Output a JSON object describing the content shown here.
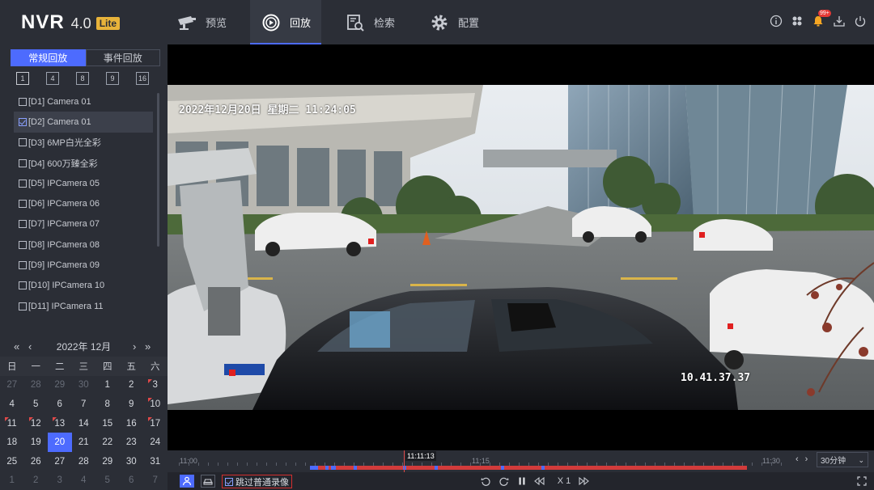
{
  "header": {
    "logo_main": "NVR",
    "logo_version": "4.0",
    "logo_badge": "Lite",
    "nav": [
      {
        "label": "预览",
        "icon": "camera-icon"
      },
      {
        "label": "回放",
        "icon": "playback-icon"
      },
      {
        "label": "检索",
        "icon": "search-doc-icon"
      },
      {
        "label": "配置",
        "icon": "gear-icon"
      }
    ],
    "active_nav": "回放",
    "notification_badge": "99+"
  },
  "sidebar": {
    "tabs": [
      "常规回放",
      "事件回放"
    ],
    "active_tab": "常规回放",
    "splits": [
      "1",
      "4",
      "8",
      "9",
      "16"
    ],
    "cameras": [
      {
        "label": "[D1] Camera 01",
        "checked": false
      },
      {
        "label": "[D2] Camera 01",
        "checked": true
      },
      {
        "label": "[D3] 6MP白光全彩",
        "checked": false
      },
      {
        "label": "[D4] 600万臻全彩",
        "checked": false
      },
      {
        "label": "[D5] IPCamera 05",
        "checked": false
      },
      {
        "label": "[D6] IPCamera 06",
        "checked": false
      },
      {
        "label": "[D7] IPCamera 07",
        "checked": false
      },
      {
        "label": "[D8] IPCamera 08",
        "checked": false
      },
      {
        "label": "[D9] IPCamera 09",
        "checked": false
      },
      {
        "label": "[D10] IPCamera 10",
        "checked": false
      },
      {
        "label": "[D11] IPCamera 11",
        "checked": false
      }
    ],
    "calendar": {
      "title": "2022年 12月",
      "nav": {
        "prev_year": "«",
        "prev_month": "‹",
        "next_month": "›",
        "next_year": "»"
      },
      "weekdays": [
        "日",
        "一",
        "二",
        "三",
        "四",
        "五",
        "六"
      ],
      "weeks": [
        [
          "27",
          "28",
          "29",
          "30",
          "1",
          "2",
          "3"
        ],
        [
          "4",
          "5",
          "6",
          "7",
          "8",
          "9",
          "10"
        ],
        [
          "11",
          "12",
          "13",
          "14",
          "15",
          "16",
          "17"
        ],
        [
          "18",
          "19",
          "20",
          "21",
          "22",
          "23",
          "24"
        ],
        [
          "25",
          "26",
          "27",
          "28",
          "29",
          "30",
          "31"
        ],
        [
          "1",
          "2",
          "3",
          "4",
          "5",
          "6",
          "7"
        ]
      ],
      "selected_day": "20",
      "recorded_days": [
        "3",
        "10",
        "11",
        "12",
        "13",
        "17"
      ]
    }
  },
  "video": {
    "osd_datetime": "2022年12月20日 星期二 11:24:05",
    "osd_ip": "10.41.37.37"
  },
  "timeline": {
    "labels": [
      "11:00",
      "11:15",
      "11:30"
    ],
    "current_time": "11:11:13",
    "zoom": "30分钟",
    "colors": {
      "recording": "#d23b3b",
      "event": "#4d6bfe"
    }
  },
  "toolbar": {
    "skip_label": "跳过普通录像",
    "speed": "X 1"
  }
}
